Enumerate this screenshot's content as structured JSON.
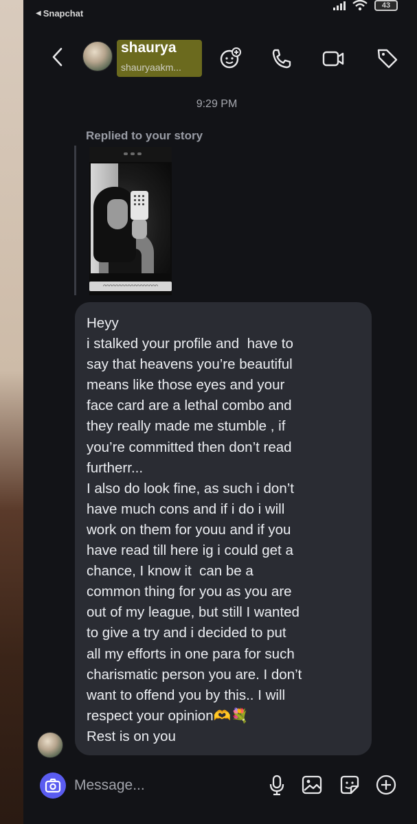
{
  "status_bar": {
    "back_app": "Snapchat",
    "battery": "43"
  },
  "header": {
    "name": "shaurya",
    "handle": "shauryaakm..."
  },
  "chat": {
    "time": "9:29 PM",
    "replied_label": "Replied to your story",
    "story_caption": "ᴖᴖᴖᴖᴖᴖᴖᴖᴖᴖᴖᴖᴖᴖᴖᴖᴖᴖ",
    "message_lines": [
      "Heyy",
      "i stalked your profile and  have to",
      "say that heavens you’re beautiful",
      "means like those eyes and your",
      "face card are a lethal combo and",
      "they really made me stumble , if",
      "you’re committed then don’t read",
      "furtherr...",
      "I also do look fine, as such i don’t",
      "have much cons and if i do i will",
      "work on them for youu and if you",
      "have read till here ig i could get a",
      "chance, I know it  can be a",
      "common thing for you as you are",
      "out of my league, but still I wanted",
      "to give a try and i decided to put",
      "all my efforts in one para for such",
      "charismatic person you are. I don’t",
      "want to offend you by this.. I will",
      "respect your opinion🫶💐",
      "Rest is on you"
    ]
  },
  "composer": {
    "placeholder": "Message..."
  },
  "colors": {
    "background": "#121317",
    "bubble": "#2a2c33",
    "camera_button": "#5a5cf0",
    "name_highlight": "#6b6a1e"
  },
  "icons": [
    "back-chevron-icon",
    "bitmoji-add-icon",
    "phone-icon",
    "video-icon",
    "tag-icon",
    "camera-icon",
    "microphone-icon",
    "gallery-icon",
    "sticker-icon",
    "plus-icon"
  ]
}
